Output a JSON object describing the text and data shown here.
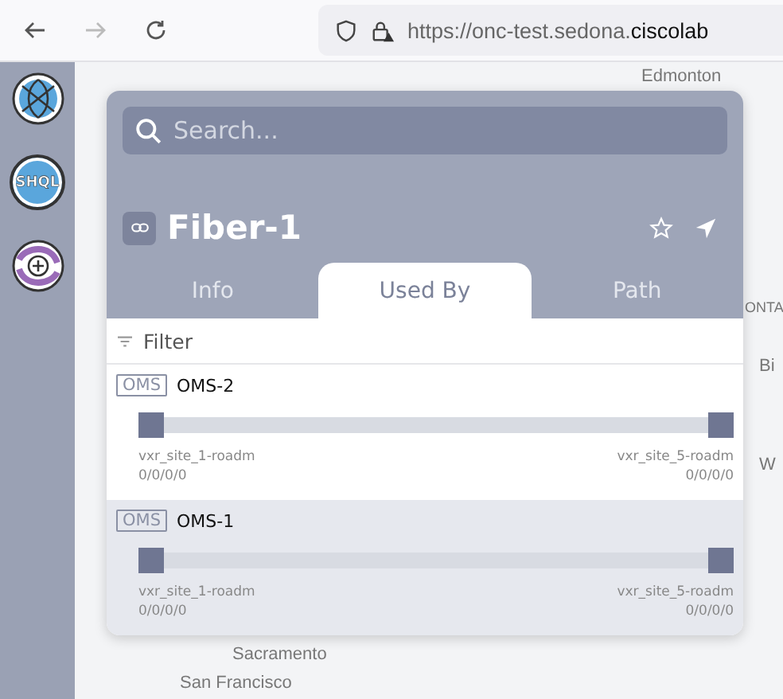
{
  "browser": {
    "url": "https://onc-test.sedona.**ciscolab**"
  },
  "sidebar": {
    "items": [
      {
        "kind": "globe"
      },
      {
        "kind": "text",
        "label": "SHQL"
      },
      {
        "kind": "add"
      }
    ]
  },
  "map": {
    "labels": [
      {
        "text": "Edmonton"
      },
      {
        "text": "ONTA"
      },
      {
        "text": "Bi"
      },
      {
        "text": "W"
      },
      {
        "text": "Sacramento"
      },
      {
        "text": "San Francisco"
      }
    ]
  },
  "panel": {
    "search": {
      "placeholder": "Search..."
    },
    "title": "Fiber-1",
    "tabs": [
      {
        "label": "Info",
        "selected": false
      },
      {
        "label": "Used By",
        "selected": true
      },
      {
        "label": "Path",
        "selected": false
      }
    ],
    "filter": "Filter",
    "rows": [
      {
        "badge": "OMS",
        "name": "OMS-2",
        "selected": false,
        "from": "vxr_site_1-roadm",
        "from_port": "0/0/0/0",
        "to": "vxr_site_5-roadm",
        "to_port": "0/0/0/0"
      },
      {
        "badge": "OMS",
        "name": "OMS-1",
        "selected": true,
        "from": "vxr_site_1-roadm",
        "from_port": "0/0/0/0",
        "to": "vxr_site_5-roadm",
        "to_port": "0/0/0/0"
      }
    ]
  }
}
